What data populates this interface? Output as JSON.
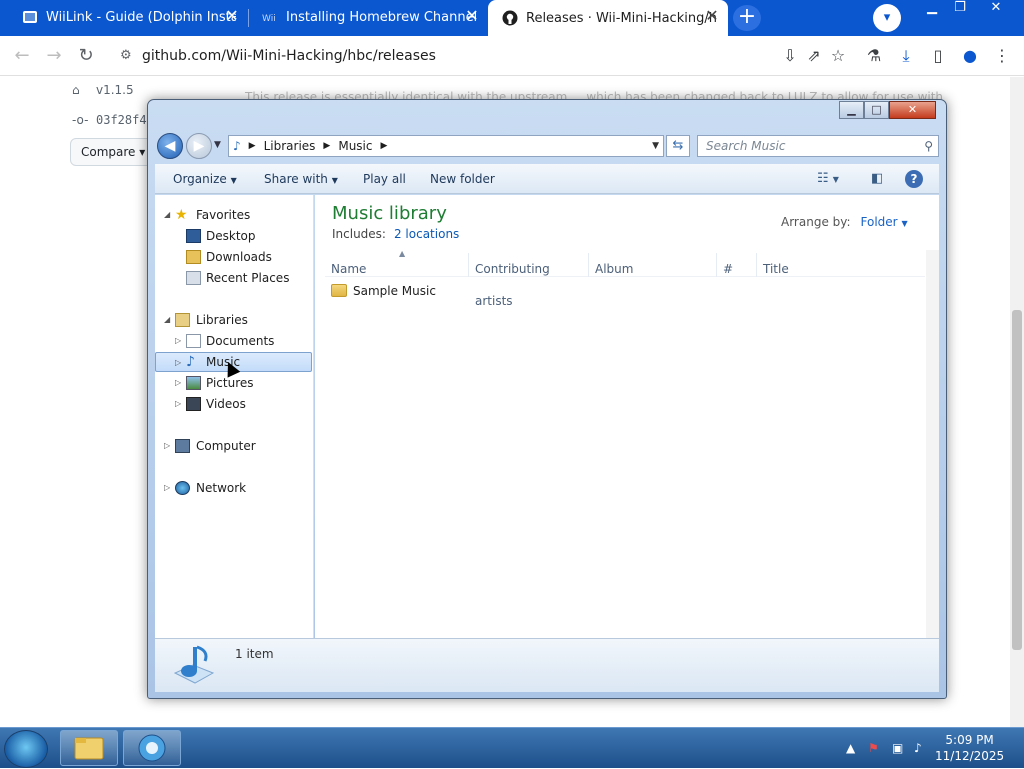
{
  "browser": {
    "tabs": [
      {
        "title": "WiiLink - Guide (Dolphin Installa",
        "close": "✕"
      },
      {
        "title": "Installing Homebrew Channel or",
        "close": "✕"
      },
      {
        "title": "Releases · Wii-Mini-Hacking/hbc",
        "close": "✕"
      }
    ],
    "new_tab": "+",
    "url": "github.com/Wii-Mini-Hacking/hbc/releases"
  },
  "page": {
    "tag": "v1.1.5",
    "commit": "03f28f4",
    "compare": "Compare",
    "text": "This release is essentially identical with the upstream ... which has been changed back to LULZ to allow for use with BootMii and other older ..."
  },
  "explorer": {
    "address": {
      "crumb1": "Libraries",
      "crumb2": "Music"
    },
    "search_placeholder": "Search Music",
    "commands": {
      "organize": "Organize",
      "share": "Share with",
      "play": "Play all",
      "new_folder": "New folder"
    },
    "nav": {
      "favorites": "Favorites",
      "desktop": "Desktop",
      "downloads": "Downloads",
      "recent": "Recent Places",
      "libraries": "Libraries",
      "documents": "Documents",
      "music": "Music",
      "pictures": "Pictures",
      "videos": "Videos",
      "computer": "Computer",
      "network": "Network"
    },
    "library": {
      "title": "Music library",
      "includes_label": "Includes:",
      "locations": "2 locations",
      "arrange_label": "Arrange by:",
      "arrange_value": "Folder"
    },
    "columns": [
      "Name",
      "Contributing artists",
      "Album",
      "#",
      "Title"
    ],
    "items": [
      {
        "name": "Sample Music"
      }
    ],
    "status": "1 item"
  },
  "taskbar": {
    "time": "5:09 PM",
    "date": "11/12/2025"
  },
  "colors": {
    "chrome_blue": "#0b57d0",
    "library_green": "#1e7c33",
    "link_blue": "#0c59b5"
  }
}
